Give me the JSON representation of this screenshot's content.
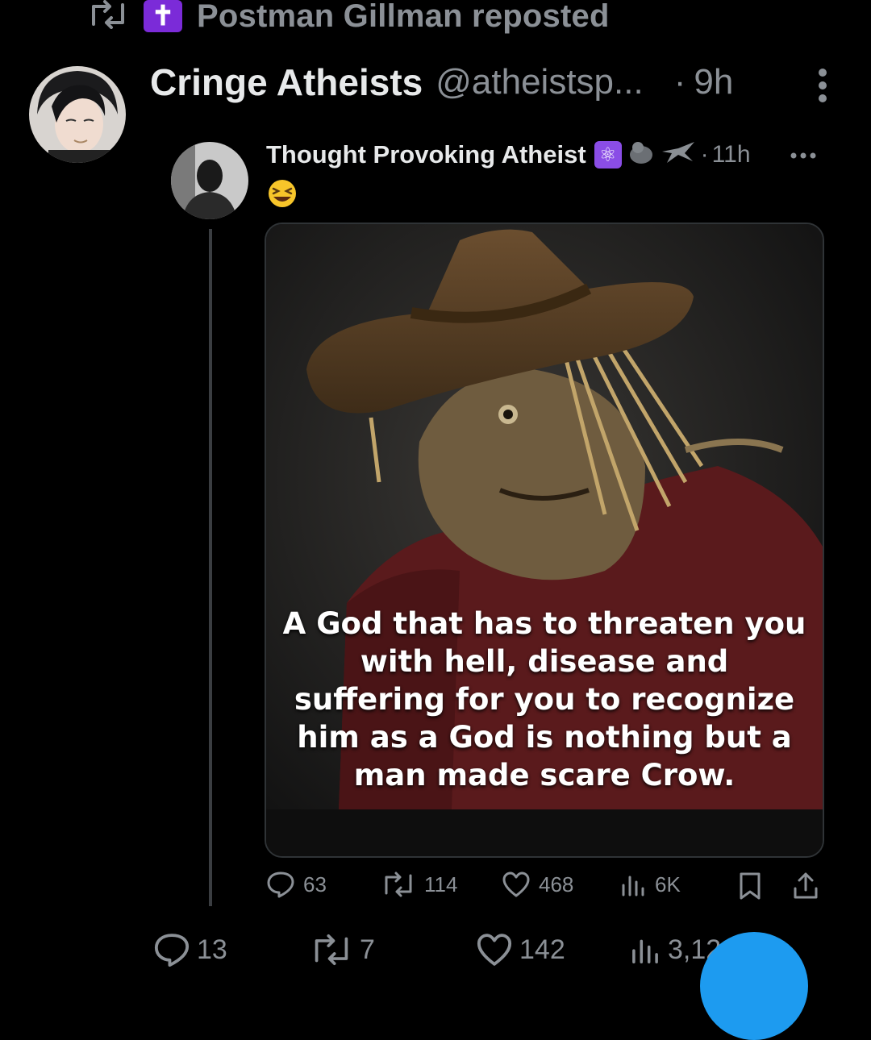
{
  "repost": {
    "badge_glyph": "✝",
    "text": "Postman Gillman reposted"
  },
  "post": {
    "display_name": "Cringe Atheists",
    "handle": "@atheistsp...",
    "dot": "·",
    "time": "9h",
    "actions": {
      "replies": "13",
      "reposts": "7",
      "likes": "142",
      "views": "3,12"
    }
  },
  "quoted": {
    "display_name": "Thought Provoking Atheist",
    "dot": "·",
    "time": "11h",
    "badge_icon": "atom-icon",
    "emoji_text": "😆",
    "media_caption": "A God that has to threaten you with hell, disease and suffering for you to recognize him as a God is nothing but a man made scare Crow.",
    "actions": {
      "replies": "63",
      "reposts": "114",
      "likes": "468",
      "views": "6K"
    }
  },
  "colors": {
    "background": "#000000",
    "muted": "#8b9096",
    "accent": "#1d9bf0",
    "cross_badge": "#7b2bd8"
  }
}
